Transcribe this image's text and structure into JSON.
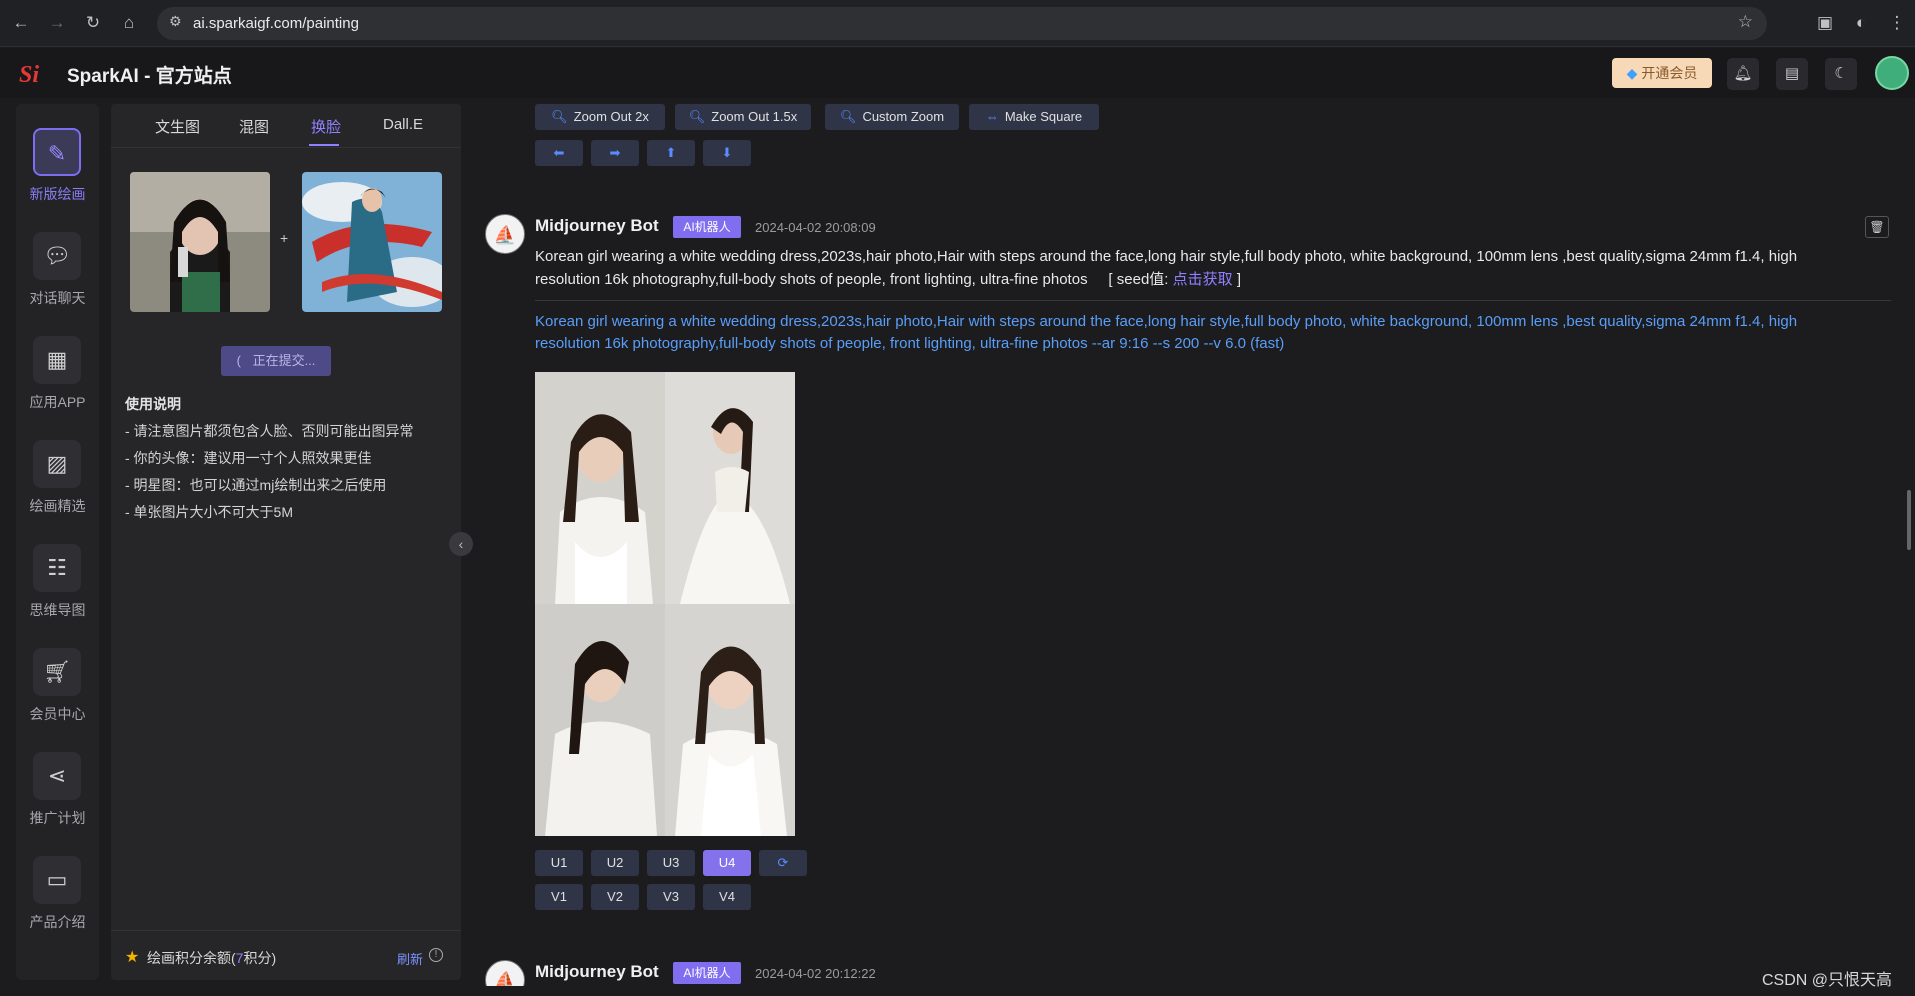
{
  "browser": {
    "url": "ai.sparkaigf.com/painting"
  },
  "header": {
    "logo_text": "Si",
    "title": "SparkAI - 官方站点",
    "vip_button": "开通会员",
    "icons": [
      "bell-icon",
      "gift-icon",
      "moon-icon"
    ]
  },
  "nav": {
    "items": [
      {
        "label": "新版绘画",
        "icon": "paint-brush-icon",
        "active": true
      },
      {
        "label": "对话聊天",
        "icon": "chat-bubble-icon",
        "active": false
      },
      {
        "label": "应用APP",
        "icon": "grid-icon",
        "active": false
      },
      {
        "label": "绘画精选",
        "icon": "image-icon",
        "active": false
      },
      {
        "label": "思维导图",
        "icon": "mindmap-icon",
        "active": false
      },
      {
        "label": "会员中心",
        "icon": "cart-icon",
        "active": false
      },
      {
        "label": "推广计划",
        "icon": "share-icon",
        "active": false
      },
      {
        "label": "产品介绍",
        "icon": "box-icon",
        "active": false
      }
    ]
  },
  "panel": {
    "tabs": [
      "文生图",
      "混图",
      "换脸",
      "Dall.E"
    ],
    "active_tab": "换脸",
    "plus": "+",
    "submit_button": "正在提交...",
    "usage_title": "使用说明",
    "usage_lines": [
      "- 请注意图片都须包含人脸、否则可能出图异常",
      "- 你的头像：建议用一寸个人照效果更佳",
      "- 明星图：也可以通过mj绘制出来之后使用",
      "- 单张图片大小不可大于5M"
    ],
    "credits_prefix": "绘画积分余额(",
    "credits_value": "7",
    "credits_suffix": "积分)",
    "refresh": "刷新"
  },
  "main": {
    "zoom_buttons": [
      "Zoom Out 2x",
      "Zoom Out 1.5x",
      "Custom Zoom",
      "Make Square"
    ],
    "arrow_buttons": [
      "⬅",
      "➡",
      "⬆",
      "⬇"
    ],
    "messages": [
      {
        "bot_name": "Midjourney Bot",
        "badge": "AI机器人",
        "time": "2024-04-02 20:08:09",
        "prompt": "Korean girl wearing a white wedding dress,2023s,hair photo,Hair with steps around the face,long hair style,full body photo, white background, 100mm lens ,best quality,sigma 24mm f1.4, high resolution 16k photography,full-body shots of people, front lighting, ultra-fine photos",
        "seed_prefix": "[ seed值:",
        "seed_link": "点击获取",
        "seed_suffix": "]",
        "full_prompt": "Korean girl wearing a white wedding dress,2023s,hair photo,Hair with steps around the face,long hair style,full body photo, white background, 100mm lens ,best quality,sigma 24mm f1.4, high resolution 16k photography,full-body shots of people, front lighting, ultra-fine photos --ar 9:16 --s 200 --v 6.0  (fast)",
        "u_buttons": [
          "U1",
          "U2",
          "U3",
          "U4"
        ],
        "active_u": "U4",
        "v_buttons": [
          "V1",
          "V2",
          "V3",
          "V4"
        ]
      },
      {
        "bot_name": "Midjourney Bot",
        "badge": "AI机器人",
        "time": "2024-04-02 20:12:22"
      }
    ]
  },
  "watermark": "CSDN @只恨天高",
  "colors": {
    "accent": "#8372ec",
    "link": "#5a9ef7",
    "button_bg": "#2f3547"
  }
}
